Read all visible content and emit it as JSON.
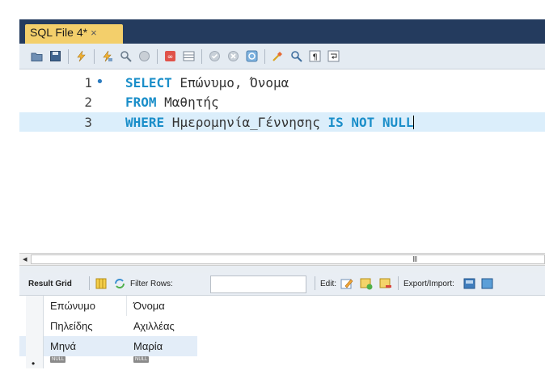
{
  "tab": {
    "title": "SQL File 4*",
    "close": "×"
  },
  "toolbar_icons": [
    "open-folder-icon",
    "save-icon",
    "execute-icon",
    "execute-current-icon",
    "explain-icon",
    "stop-icon",
    "toggle-stop-on-error-icon",
    "toggle-result-panel-icon",
    "commit-icon",
    "rollback-icon",
    "autocommit-icon",
    "beautify-icon",
    "find-icon",
    "invisible-chars-icon",
    "word-wrap-icon"
  ],
  "editor": {
    "lines": [
      {
        "num": "1",
        "marker": "•",
        "parts": [
          {
            "t": "SELECT",
            "kw": true
          },
          {
            "t": " Επώνυμο, Όνομα",
            "kw": false
          }
        ]
      },
      {
        "num": "2",
        "marker": "",
        "parts": [
          {
            "t": "FROM",
            "kw": true
          },
          {
            "t": " Μαθητής",
            "kw": false
          }
        ]
      },
      {
        "num": "3",
        "marker": "",
        "parts": [
          {
            "t": "WHERE",
            "kw": true
          },
          {
            "t": " Ημερομηνία_Γέννησης ",
            "kw": false
          },
          {
            "t": "IS NOT NULL",
            "kw": true
          }
        ]
      }
    ]
  },
  "scrollbar": {
    "left_arrow": "◂",
    "grip": "III"
  },
  "results_toolbar": {
    "result_grid": "Result Grid",
    "filter_rows": "Filter Rows:",
    "filter_value": "",
    "edit": "Edit:",
    "export_import": "Export/Import:"
  },
  "grid": {
    "columns": [
      "Επώνυμο",
      "Όνομα"
    ],
    "rows": [
      [
        "Πηλείδης",
        "Αχιλλέας"
      ],
      [
        "Μηνά",
        "Μαρία"
      ]
    ],
    "new_row": {
      "marker": "•",
      "values": [
        "NULL",
        "NULL"
      ]
    }
  }
}
